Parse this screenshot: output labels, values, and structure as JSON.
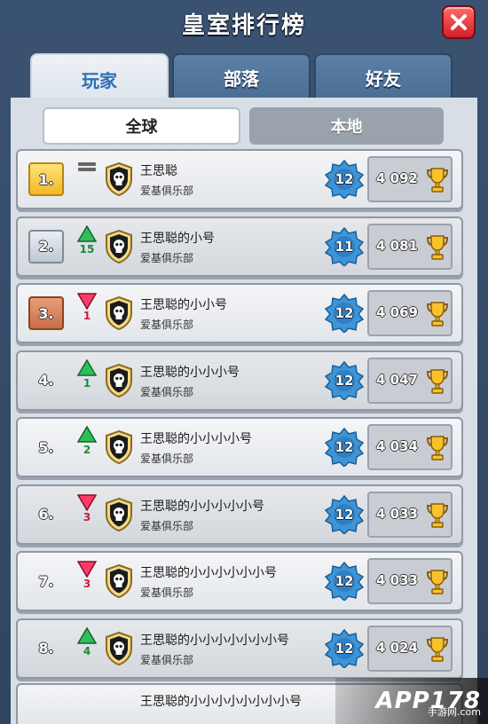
{
  "header": {
    "title": "皇室排行榜"
  },
  "tabs": [
    {
      "label": "玩家",
      "active": true
    },
    {
      "label": "部落",
      "active": false
    },
    {
      "label": "好友",
      "active": false
    }
  ],
  "subtabs": [
    {
      "label": "全球",
      "active": true
    },
    {
      "label": "本地",
      "active": false
    }
  ],
  "rows": [
    {
      "rank": "1.",
      "medal": "gold",
      "trend": "same",
      "change": "",
      "name": "王思聪",
      "clan": "爱基俱乐部",
      "level": "12",
      "trophies": "4 092"
    },
    {
      "rank": "2.",
      "medal": "silver",
      "trend": "up",
      "change": "15",
      "name": "王思聪的小号",
      "clan": "爱基俱乐部",
      "level": "11",
      "trophies": "4 081"
    },
    {
      "rank": "3.",
      "medal": "bronze",
      "trend": "down",
      "change": "1",
      "name": "王思聪的小小号",
      "clan": "爱基俱乐部",
      "level": "12",
      "trophies": "4 069"
    },
    {
      "rank": "4.",
      "medal": "none",
      "trend": "up",
      "change": "1",
      "name": "王思聪的小小小号",
      "clan": "爱基俱乐部",
      "level": "12",
      "trophies": "4 047"
    },
    {
      "rank": "5.",
      "medal": "none",
      "trend": "up",
      "change": "2",
      "name": "王思聪的小小小小号",
      "clan": "爱基俱乐部",
      "level": "12",
      "trophies": "4 034"
    },
    {
      "rank": "6.",
      "medal": "none",
      "trend": "down",
      "change": "3",
      "name": "王思聪的小小小小小号",
      "clan": "爱基俱乐部",
      "level": "12",
      "trophies": "4 033"
    },
    {
      "rank": "7.",
      "medal": "none",
      "trend": "down",
      "change": "3",
      "name": "王思聪的小小小小小小号",
      "clan": "爱基俱乐部",
      "level": "12",
      "trophies": "4 033"
    },
    {
      "rank": "8.",
      "medal": "none",
      "trend": "up",
      "change": "4",
      "name": "王思聪的小小小小小小小号",
      "clan": "爱基俱乐部",
      "level": "12",
      "trophies": "4 024"
    }
  ],
  "partial_row": {
    "name": "王思聪的小小小小小小小小号"
  },
  "watermark": {
    "brand": "APP178",
    "sub": "手游网",
    "domain": ".com"
  },
  "colors": {
    "up": "#1d8a3a",
    "down": "#c81a3a",
    "gold": "#f2b824",
    "accent": "#2e6fb5"
  }
}
